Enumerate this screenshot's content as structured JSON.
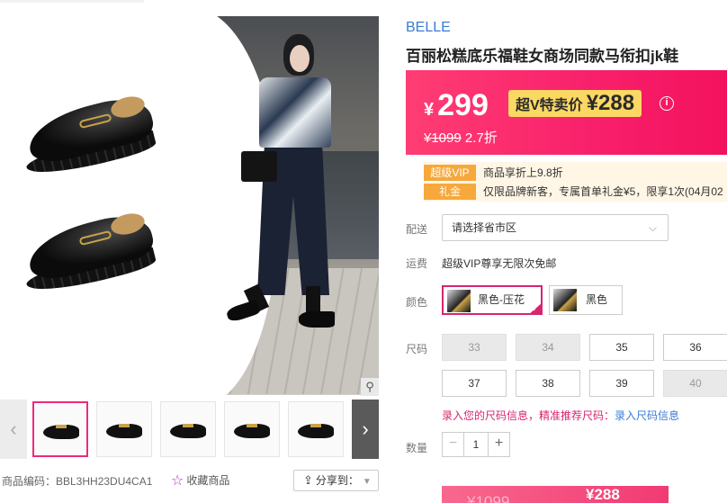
{
  "gallery": {
    "zoom_icon": "magnifier-icon",
    "prev_glyph": "‹",
    "next_glyph": "›",
    "thumb_count": 6
  },
  "footer": {
    "sku_label": "商品编码：BBL3HH23DU4CA1",
    "favorite_label": "收藏商品",
    "share_label": "分享到："
  },
  "product": {
    "brand": "BELLE",
    "title": "百丽松糕底乐福鞋女商场同款马衔扣jk鞋"
  },
  "price": {
    "currency": "¥",
    "current": "299",
    "svip_label": "超V特卖价",
    "svip_price": "¥288",
    "original": "¥1099",
    "discount": "2.7折"
  },
  "promotions": [
    {
      "tag": "超级VIP",
      "text": "商品享折上9.8折"
    },
    {
      "tag": "礼金",
      "text": "仅限品牌新客，专属首单礼金¥5，限享1次(04月02"
    }
  ],
  "delivery": {
    "label": "配送",
    "placeholder": "请选择省市区"
  },
  "shipping": {
    "label": "运费",
    "text": "超级VIP尊享无限次免邮"
  },
  "colors": {
    "label": "颜色",
    "options": [
      {
        "name": "黑色-压花",
        "selected": true
      },
      {
        "name": "黑色",
        "selected": false
      }
    ]
  },
  "sizes": {
    "label": "尺码",
    "options": [
      {
        "value": "33",
        "available": false
      },
      {
        "value": "34",
        "available": false
      },
      {
        "value": "35",
        "available": true
      },
      {
        "value": "36",
        "available": true
      },
      {
        "value": "37",
        "available": true
      },
      {
        "value": "38",
        "available": true
      },
      {
        "value": "39",
        "available": true
      },
      {
        "value": "40",
        "available": false
      }
    ],
    "tip": "录入您的尺码信息，精准推荐尺码：",
    "tip_link": "录入尺码信息"
  },
  "quantity": {
    "label": "数量",
    "value": "1",
    "minus": "−",
    "plus": "+"
  },
  "buy": {
    "old_price": "¥1099",
    "new_price": "¥288"
  },
  "colors_theme": {
    "accent": "#ee2a7b",
    "price_banner": "#f81f6b",
    "svip_badge": "#fbd863",
    "promo_tag": "#f6a83c",
    "link": "#3a7bd5"
  }
}
